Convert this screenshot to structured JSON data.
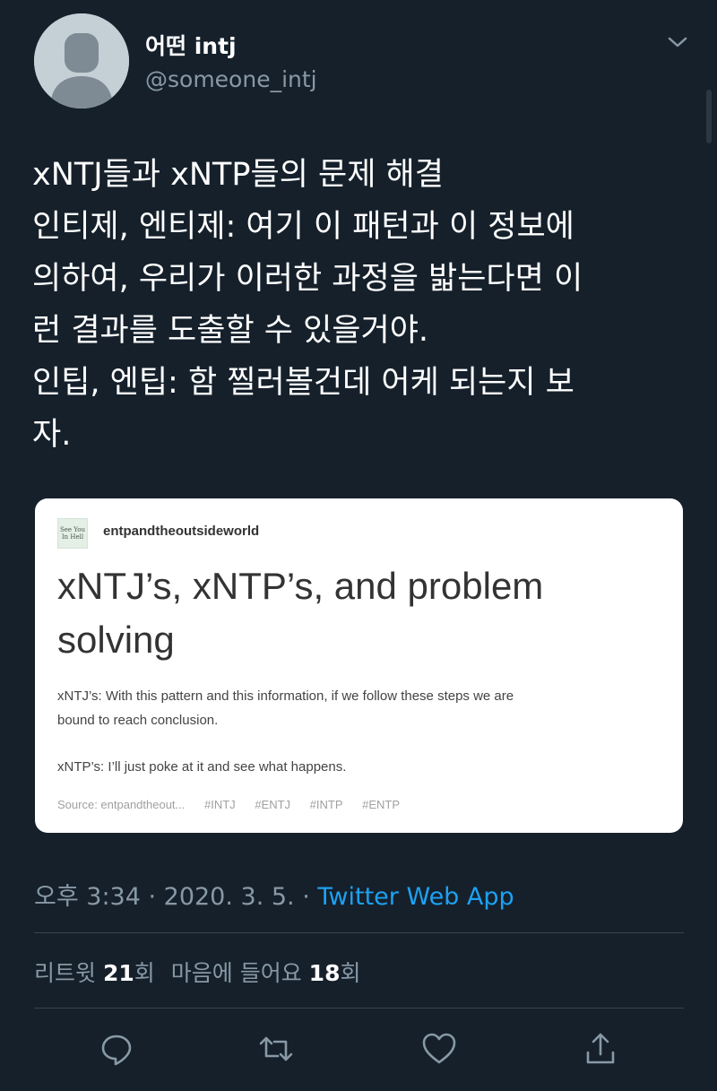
{
  "user": {
    "display_name": "어떤 intj",
    "handle": "@someone_intj"
  },
  "tweet": {
    "lines": [
      "xNTJ들과 xNTP들의 문제 해결",
      "인티제, 엔티제: 여기 이 패턴과 이 정보에",
      "의하여, 우리가 이러한 과정을 밟는다면 이",
      "런 결과를 도출할 수 있을거야.",
      "인팁, 엔팁: 함 찔러볼건데 어케 되는지 보",
      "자."
    ]
  },
  "card": {
    "logo_text": "See You In Hell",
    "author": "entpandtheoutsideworld",
    "title_line1": "xNTJ’s, xNTP’s, and problem",
    "title_line2": "solving",
    "body_line1": "xNTJ’s: With this pattern and this information, if we follow these steps we are",
    "body_line2": "bound to reach conclusion.",
    "body2": "xNTP’s: I’ll just poke at it and see what happens.",
    "source": "Source: entpandtheout...",
    "tags": [
      "#INTJ",
      "#ENTJ",
      "#INTP",
      "#ENTP"
    ]
  },
  "meta": {
    "time_date": "오후 3:34 · 2020. 3. 5. · ",
    "app": "Twitter Web App"
  },
  "stats": {
    "retweet_label": "리트윗 ",
    "retweet_count": "21",
    "retweet_unit": "회",
    "like_label": "마음에 들어요 ",
    "like_count": "18",
    "like_unit": "회"
  },
  "icons": {
    "reply": "reply-icon",
    "retweet": "retweet-icon",
    "like": "heart-icon",
    "share": "share-icon"
  },
  "colors": {
    "background": "#15202b",
    "secondary_text": "#8899a6",
    "link": "#1da1f2",
    "divider": "#38444d"
  }
}
